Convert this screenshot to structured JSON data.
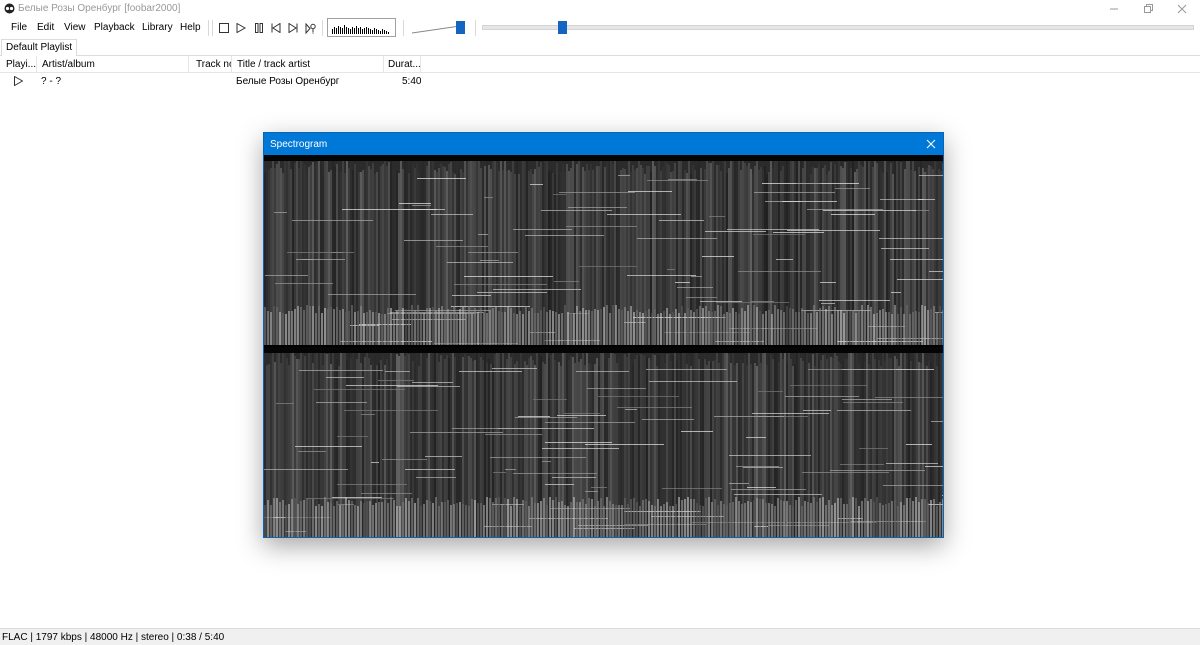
{
  "window": {
    "title": "Белые Розы Оренбург  [foobar2000]"
  },
  "menu": {
    "items": [
      "File",
      "Edit",
      "View",
      "Playback",
      "Library",
      "Help"
    ]
  },
  "toolbar": {
    "buttons": [
      "stop-icon",
      "play-icon",
      "pause-icon",
      "previous-icon",
      "next-icon",
      "random-icon"
    ],
    "seek_position_fraction": 0.11,
    "volume_fraction": 1.0
  },
  "tabs": [
    {
      "label": "Default Playlist",
      "active": true
    }
  ],
  "playlist": {
    "columns": [
      "Playi...",
      "Artist/album",
      "Track no",
      "Title / track artist",
      "Durat..."
    ],
    "rows": [
      {
        "playing_icon": "play-outline-icon",
        "artist_album": "? - ?",
        "track_no": "",
        "title": "Белые Розы Оренбург",
        "duration": "5:40"
      }
    ]
  },
  "status": {
    "text": "FLAC | 1797 kbps | 48000 Hz | stereo | 0:38 / 5:40"
  },
  "spectrogram": {
    "title": "Spectrogram",
    "channels": 2,
    "colors": {
      "titlebar": "#0078d7",
      "background": "#000000"
    }
  }
}
